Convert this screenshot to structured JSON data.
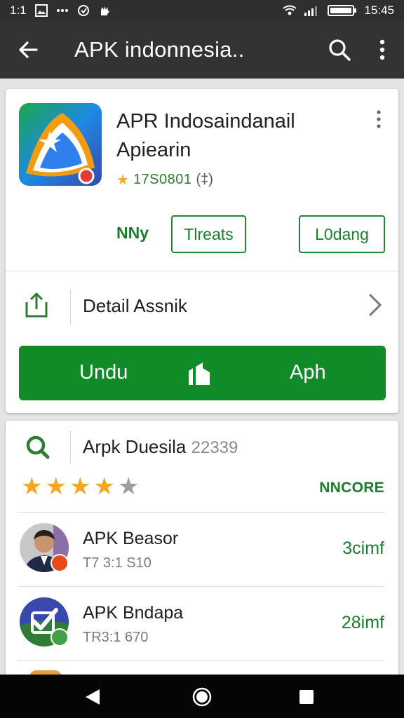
{
  "status_bar": {
    "left_text": "1:1",
    "time": "15:45"
  },
  "app_bar": {
    "title": "APK indonnesia.."
  },
  "app_card": {
    "name": "APR Indosaindanail Apiearin",
    "rating_text": "17S0801",
    "rating_suffix": "(‡)",
    "nny_label": "NNy",
    "threats_button": "Tlreats",
    "lodang_button": "L0dang",
    "detail_label": "Detail Assnik",
    "download_left": "Undu",
    "download_right": "Aph"
  },
  "results_card": {
    "search_label": "Arpk Duesila",
    "search_count": "22339",
    "stars_filled": 4,
    "stars_total": 5,
    "ncore_label": "NNCORE",
    "items": [
      {
        "name": "APK Beasor",
        "sub": "T7 3:1 S10",
        "meta": "3cimf"
      },
      {
        "name": "APK Bndapa",
        "sub": "TR3:1 670",
        "meta": "28imf"
      }
    ]
  },
  "colors": {
    "accent_green": "#118a28",
    "app_bar": "#333333",
    "star": "#f5a623"
  }
}
